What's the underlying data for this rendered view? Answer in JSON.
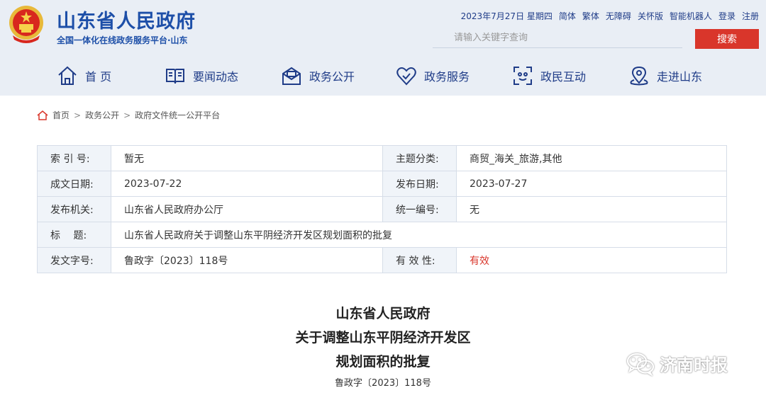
{
  "header": {
    "site_title": "山东省人民政府",
    "site_subtitle": "全国一体化在线政务服务平台·山东",
    "date": "2023年7月27日 星期四",
    "top_links": [
      "简体",
      "繁体",
      "无障碍",
      "关怀版",
      "智能机器人",
      "登录",
      "注册"
    ],
    "search_placeholder": "请输入关键字查询",
    "search_button": "搜索",
    "brand_color": "#1d4fa8",
    "accent_color": "#d9362b"
  },
  "nav": [
    {
      "label": "首 页",
      "icon": "home-icon"
    },
    {
      "label": "要闻动态",
      "icon": "news-book-icon"
    },
    {
      "label": "政务公开",
      "icon": "envelope-icon"
    },
    {
      "label": "政务服务",
      "icon": "heart-icon"
    },
    {
      "label": "政民互动",
      "icon": "interaction-icon"
    },
    {
      "label": "走进山东",
      "icon": "location-pin-icon"
    }
  ],
  "breadcrumb": [
    "首页",
    "政务公开",
    "政府文件统一公开平台"
  ],
  "info": {
    "index_label": "索 引 号:",
    "index_value": "暂无",
    "topic_label": "主题分类:",
    "topic_value": "商贸_海关_旅游,其他",
    "created_label": "成文日期:",
    "created_value": "2023-07-22",
    "published_label": "发布日期:",
    "published_value": "2023-07-27",
    "issuer_label": "发布机关:",
    "issuer_value": "山东省人民政府办公厅",
    "serial_label": "统一编号:",
    "serial_value": "无",
    "title_label": "标　 题:",
    "title_value": "山东省人民政府关于调整山东平阴经济开发区规划面积的批复",
    "docno_label": "发文字号:",
    "docno_value": "鲁政字〔2023〕118号",
    "validity_label": "有 效 性:",
    "validity_value": "有效"
  },
  "document": {
    "title_line1": "山东省人民政府",
    "title_line2": "关于调整山东平阴经济开发区",
    "title_line3": "规划面积的批复",
    "number": "鲁政字〔2023〕118号"
  },
  "watermark": {
    "text": "济南时报",
    "icon": "wechat-icon"
  }
}
